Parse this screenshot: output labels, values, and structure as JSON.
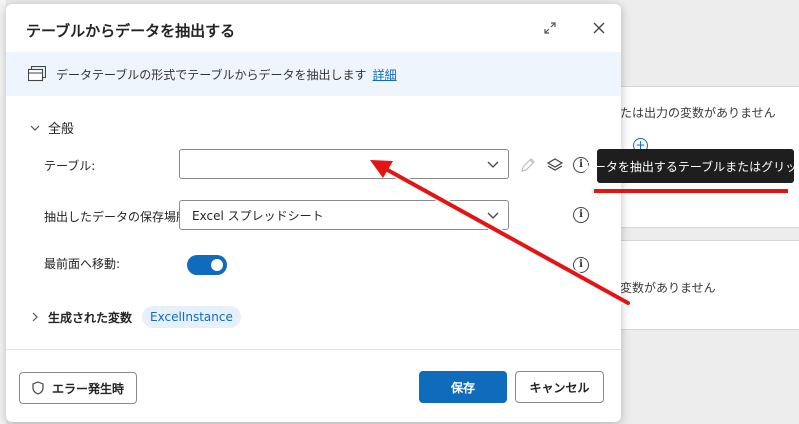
{
  "background": {
    "panel_text_1": "たは出力の変数がありません",
    "panel_text_2": "変数がありません"
  },
  "dialog": {
    "title": "テーブルからデータを抽出する",
    "info_text": "データテーブルの形式でテーブルからデータを抽出します",
    "info_link": "詳細",
    "section_general": "全般",
    "fields": {
      "table_label": "テーブル:",
      "table_value": "",
      "storage_label": "抽出したデータの保存場所:",
      "storage_value": "Excel スプレッドシート",
      "foreground_label": "最前面へ移動:",
      "foreground_enabled": true
    },
    "generated_vars_label": "生成された変数",
    "generated_var_name": "ExcelInstance",
    "footer": {
      "on_error_label": "エラー発生時",
      "save_label": "保存",
      "cancel_label": "キャンセル"
    }
  },
  "tooltip": {
    "text": "データを抽出するテーブルまたはグリッド"
  },
  "colors": {
    "accent": "#0f6cbd",
    "annotation_red": "#e41414",
    "tooltip_bg": "#1e1e1e"
  },
  "icons": [
    "table-icon",
    "expand-icon",
    "close-icon",
    "chevron-down-icon",
    "chevron-right-icon",
    "pencil-icon",
    "layers-icon",
    "info-icon",
    "shield-icon"
  ]
}
